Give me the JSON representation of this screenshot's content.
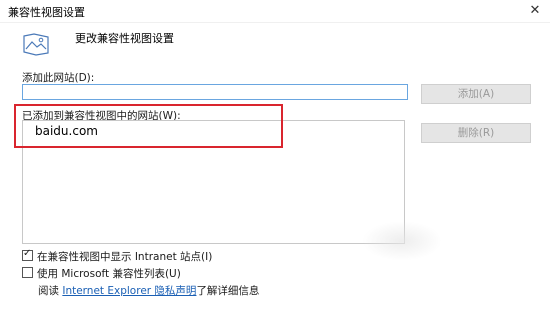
{
  "window": {
    "title": "兼容性视图设置",
    "close_glyph": "✕"
  },
  "header": {
    "text": "更改兼容性视图设置",
    "icon": "compat-view-icon"
  },
  "add_site": {
    "label": "添加此网站(D):",
    "value": "",
    "button_label": "添加(A)"
  },
  "sites_list": {
    "label": "已添加到兼容性视图中的网站(W):",
    "items": [
      "baidu.com"
    ],
    "remove_label": "删除(R)"
  },
  "options": {
    "intranet": {
      "label": "在兼容性视图中显示 Intranet 站点(I)",
      "checked": true
    },
    "ms_list": {
      "label": "使用 Microsoft 兼容性列表(U)",
      "checked": false
    }
  },
  "info": {
    "prefix": "阅读 ",
    "link": "Internet Explorer 隐私声明",
    "suffix": "了解详细信息"
  },
  "colors": {
    "highlight": "#d9252e",
    "input_border": "#6aa6e0",
    "link": "#1a5fb4"
  }
}
